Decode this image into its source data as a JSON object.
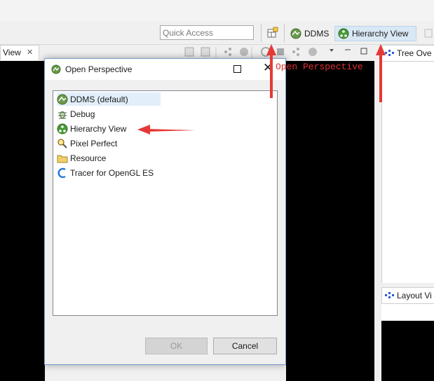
{
  "toolbar": {
    "quick_access_placeholder": "Quick Access",
    "perspectives": [
      {
        "label": "DDMS",
        "icon": "ddms-icon"
      },
      {
        "label": "Hierarchy View",
        "icon": "hierarchy-view-icon",
        "active": true
      }
    ]
  },
  "left_view": {
    "tab_label": "View",
    "close_glyph": "✕"
  },
  "right_views": {
    "tree_overview_tab": "Tree Ove",
    "layout_view_tab": "Layout Vi"
  },
  "dialog": {
    "title": "Open Perspective",
    "close_glyph": "✕",
    "items": [
      {
        "label": "DDMS (default)",
        "icon": "ddms-icon",
        "selected": true
      },
      {
        "label": "Debug",
        "icon": "bug-icon"
      },
      {
        "label": "Hierarchy View",
        "icon": "hierarchy-view-icon"
      },
      {
        "label": "Pixel Perfect",
        "icon": "magnifier-icon"
      },
      {
        "label": "Resource",
        "icon": "folder-icon"
      },
      {
        "label": "Tracer for OpenGL ES",
        "icon": "tracer-icon"
      }
    ],
    "ok_label": "OK",
    "cancel_label": "Cancel"
  },
  "annotation": {
    "text": "Open Perspective",
    "color": "#e03030"
  },
  "colors": {
    "accent": "#d9e8f5",
    "annotation_red": "#e03030"
  }
}
